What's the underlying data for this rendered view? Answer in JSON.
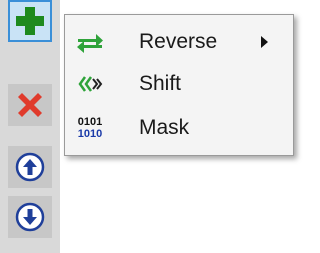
{
  "toolbar": {
    "buttons": [
      {
        "name": "add",
        "icon": "plus-icon",
        "color": "#1e8a1e",
        "active": true
      },
      {
        "name": "delete",
        "icon": "x-icon",
        "color": "#e03b2c",
        "active": false
      },
      {
        "name": "move-up",
        "icon": "circle-arrow-up-icon",
        "color": "#1f3f9a",
        "active": false
      },
      {
        "name": "move-down",
        "icon": "circle-arrow-down-icon",
        "color": "#1f3f9a",
        "active": false
      }
    ]
  },
  "menu": {
    "items": [
      {
        "label": "Reverse",
        "icon": "swap-arrows-icon",
        "has_submenu": true
      },
      {
        "label": "Shift",
        "icon": "double-chevron-icon",
        "has_submenu": false
      },
      {
        "label": "Mask",
        "icon": "binary-icon",
        "icon_text_top": "0101",
        "icon_text_bottom": "1010",
        "has_submenu": false
      }
    ]
  },
  "colors": {
    "menu_background": "#f4f4f4",
    "active_border": "#3a8fd8",
    "green_icon": "#2fa33a"
  }
}
